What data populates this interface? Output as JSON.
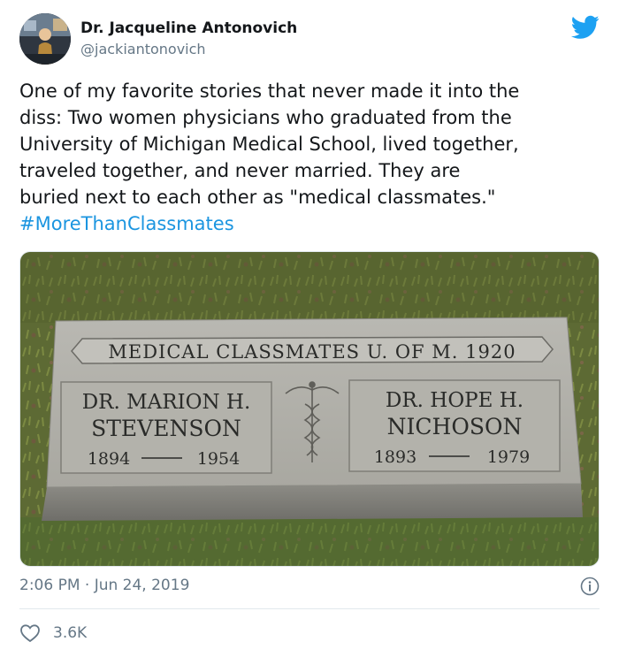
{
  "author": {
    "name": "Dr. Jacqueline Antonovich",
    "handle": "@jackiantonovich",
    "avatar_icon": "profile-photo"
  },
  "tweet": {
    "lines": [
      "One of my favorite stories that never made it into the",
      "diss: Two women physicians who graduated from the",
      "University of Michigan Medical School, lived together,",
      "traveled together, and never married. They are",
      "buried next to each other as \"medical classmates.\""
    ],
    "hashtag": "#MoreThanClassmates"
  },
  "photo": {
    "banner": "MEDICAL CLASSMATES U. OF M. 1920",
    "left": {
      "name": "DR. MARION H.",
      "surname": "STEVENSON",
      "born": "1894",
      "died": "1954"
    },
    "right": {
      "name": "DR. HOPE H.",
      "surname": "NICHOSON",
      "born": "1893",
      "died": "1979"
    }
  },
  "footer": {
    "timestamp": "2:06 PM · Jun 24, 2019",
    "likes": "3.6K"
  },
  "colors": {
    "brand": "#1da1f2",
    "hashtag": "#1b95e0",
    "muted": "#657786"
  }
}
